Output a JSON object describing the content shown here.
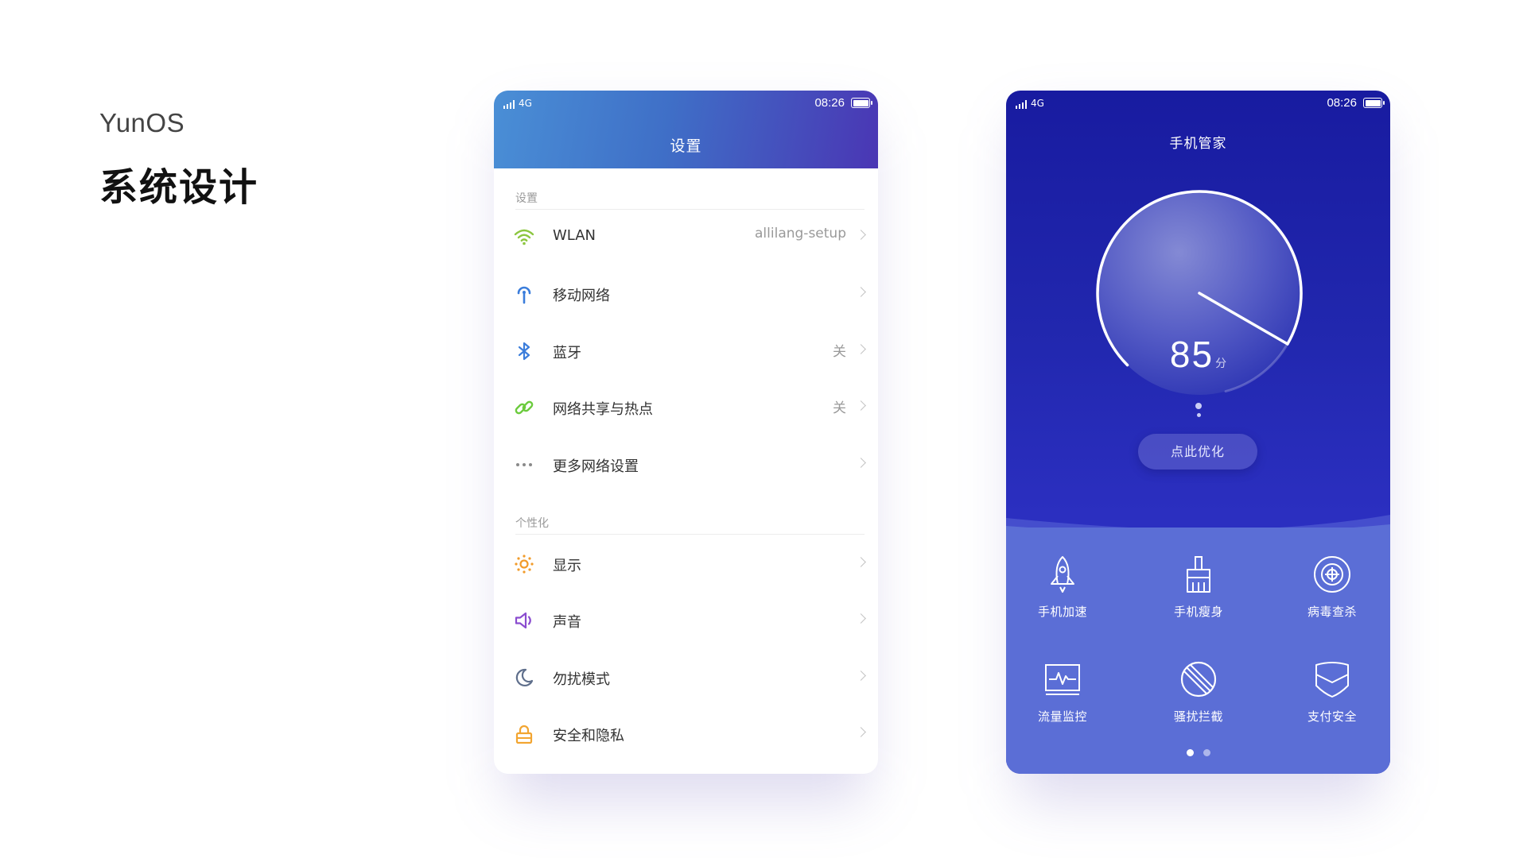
{
  "brand": "YunOS",
  "headline": "系统设计",
  "status": {
    "network": "4G",
    "time": "08:26"
  },
  "settings": {
    "title": "设置",
    "sections": [
      {
        "label": "设置",
        "rows": [
          {
            "icon": "wifi-icon",
            "color": "#8cc63f",
            "label": "WLAN",
            "value": "allilang-setup"
          },
          {
            "icon": "antenna-icon",
            "color": "#3b7ddb",
            "label": "移动网络",
            "value": ""
          },
          {
            "icon": "bluetooth-icon",
            "color": "#3b7ddb",
            "label": "蓝牙",
            "value": "关"
          },
          {
            "icon": "link-icon",
            "color": "#6ccb3e",
            "label": "网络共享与热点",
            "value": "关"
          },
          {
            "icon": "more-dots-icon",
            "color": "#8a8a8a",
            "label": "更多网络设置",
            "value": ""
          }
        ]
      },
      {
        "label": "个性化",
        "rows": [
          {
            "icon": "brightness-icon",
            "color": "#f29b2a",
            "label": "显示",
            "value": ""
          },
          {
            "icon": "speaker-icon",
            "color": "#8a4ccf",
            "label": "声音",
            "value": ""
          },
          {
            "icon": "moon-icon",
            "color": "#5f6f8c",
            "label": "勿扰模式",
            "value": ""
          },
          {
            "icon": "lock-icon",
            "color": "#f2a531",
            "label": "安全和隐私",
            "value": ""
          }
        ]
      }
    ]
  },
  "manager": {
    "title": "手机管家",
    "score": "85",
    "score_unit": "分",
    "score_fraction": 0.85,
    "optimize_label": "点此优化",
    "tools": [
      {
        "icon": "rocket-icon",
        "label": "手机加速"
      },
      {
        "icon": "broom-icon",
        "label": "手机瘦身"
      },
      {
        "icon": "virus-scan-icon",
        "label": "病毒查杀"
      },
      {
        "icon": "traffic-monitor-icon",
        "label": "流量监控"
      },
      {
        "icon": "block-icon",
        "label": "骚扰拦截"
      },
      {
        "icon": "shield-icon",
        "label": "支付安全"
      }
    ],
    "page_count": 2,
    "active_page": 0
  }
}
